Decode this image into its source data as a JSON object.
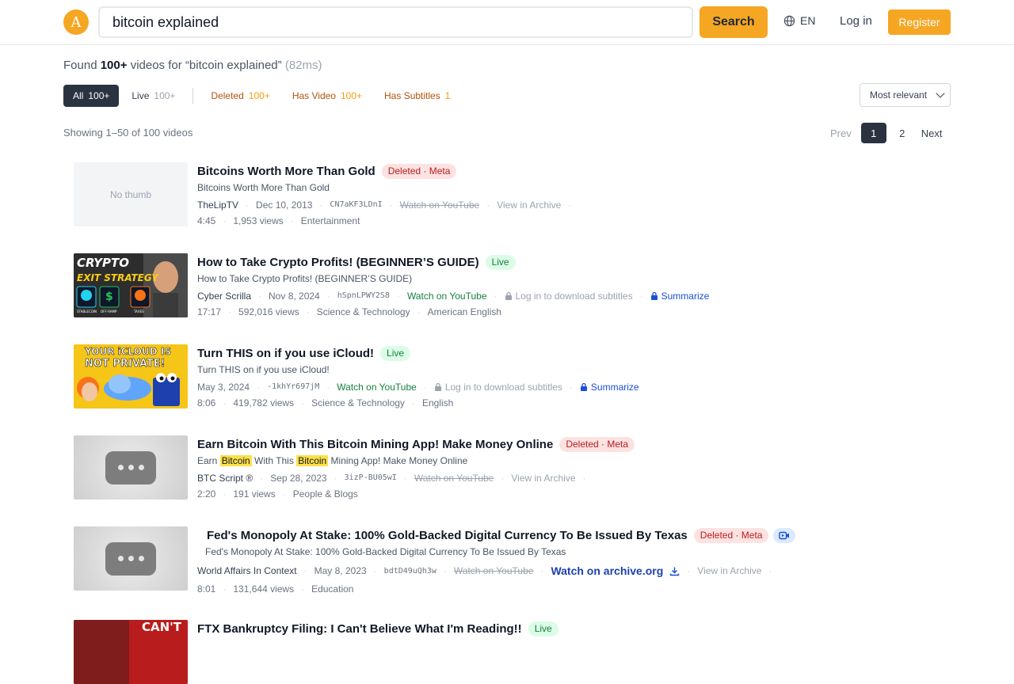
{
  "header": {
    "logo_char": "A",
    "search_value": "bitcoin explained",
    "search_button": "Search",
    "lang": "EN",
    "login": "Log in",
    "register": "Register"
  },
  "summary": {
    "found_prefix": "Found",
    "count": "100+",
    "mid": "videos for",
    "query_quoted": "“bitcoin explained”",
    "elapsed": "(82ms)"
  },
  "filters": {
    "all": {
      "label": "All",
      "count": "100+"
    },
    "live": {
      "label": "Live",
      "count": "100+"
    },
    "deleted": {
      "label": "Deleted",
      "count": "100+"
    },
    "has_video": {
      "label": "Has Video",
      "count": "100+"
    },
    "has_subtitles": {
      "label": "Has Subtitles",
      "count": "1"
    }
  },
  "sort": {
    "selected": "Most relevant"
  },
  "pager": {
    "showing": "Showing 1–50 of 100 videos",
    "prev": "Prev",
    "pages": [
      "1",
      "2"
    ],
    "current": "1",
    "next": "Next"
  },
  "results": [
    {
      "title": "Bitcoins Worth More Than Gold",
      "badge": "Deleted · Meta",
      "thumb_text": "No thumb",
      "desc": "Bitcoins Worth More Than Gold",
      "channel": "TheLipTV",
      "date": "Dec 10, 2013",
      "video_id": "CN7aKF3LDnI",
      "youtube": "Watch on YouTube",
      "archive": "View in Archive",
      "duration": "4:45",
      "views": "1,953 views",
      "category": "Entertainment"
    },
    {
      "title": "How to Take Crypto Profits! (BEGINNER’S GUIDE)",
      "badge": "Live",
      "thumb_line1": "CRYPTO",
      "thumb_line2": "EXIT STRATEGY",
      "thumb_labels": [
        "STABLECOIN",
        "OFF-RAMP",
        "TAXES"
      ],
      "desc": "How to Take Crypto Profits! (BEGINNER’S GUIDE)",
      "channel": "Cyber Scrilla",
      "date": "Nov 8, 2024",
      "video_id": "hSpnLPWY2S8",
      "youtube": "Watch on YouTube",
      "subs": "Log in to download subtitles",
      "summarize": "Summarize",
      "duration": "17:17",
      "views": "592,016 views",
      "category": "Science & Technology",
      "language": "American English"
    },
    {
      "title": "Turn THIS on if you use iCloud!",
      "badge": "Live",
      "thumb_line1": "YOUR iCLOUD IS",
      "thumb_line2": "NOT PRIVATE!",
      "desc": "Turn THIS on if you use iCloud!",
      "date": "May 3, 2024",
      "video_id": "-1khYr697jM",
      "youtube": "Watch on YouTube",
      "subs": "Log in to download subtitles",
      "summarize": "Summarize",
      "duration": "8:06",
      "views": "419,782 views",
      "category": "Science & Technology",
      "language": "English"
    },
    {
      "title": "Earn Bitcoin With This Bitcoin Mining App! Make Money Online",
      "badge": "Deleted · Meta",
      "desc_parts": [
        "Earn ",
        "Bitcoin",
        " With This ",
        "Bitcoin",
        " Mining App! Make Money Online"
      ],
      "channel": "BTC Script ®",
      "date": "Sep 28, 2023",
      "video_id": "3izP-BU05wI",
      "youtube": "Watch on YouTube",
      "archive": "View in Archive",
      "duration": "2:20",
      "views": "191 views",
      "category": "People & Blogs"
    },
    {
      "title": "Fed's Monopoly At Stake: 100% Gold-Backed Digital Currency To Be Issued By Texas",
      "badge": "Deleted · Meta",
      "desc": "Fed's Monopoly At Stake: 100% Gold-Backed Digital Currency To Be Issued By Texas",
      "channel": "World Affairs In Context",
      "date": "May 8, 2023",
      "video_id": "bdtD49uQh3w",
      "youtube": "Watch on YouTube",
      "archive_org": "Watch on archive.org",
      "archive": "View in Archive",
      "duration": "8:01",
      "views": "131,644 views",
      "category": "Education"
    },
    {
      "title": "FTX Bankruptcy Filing: I Can't Believe What I'm Reading!!",
      "badge": "Live",
      "thumb_line1": "CAN'T"
    }
  ]
}
